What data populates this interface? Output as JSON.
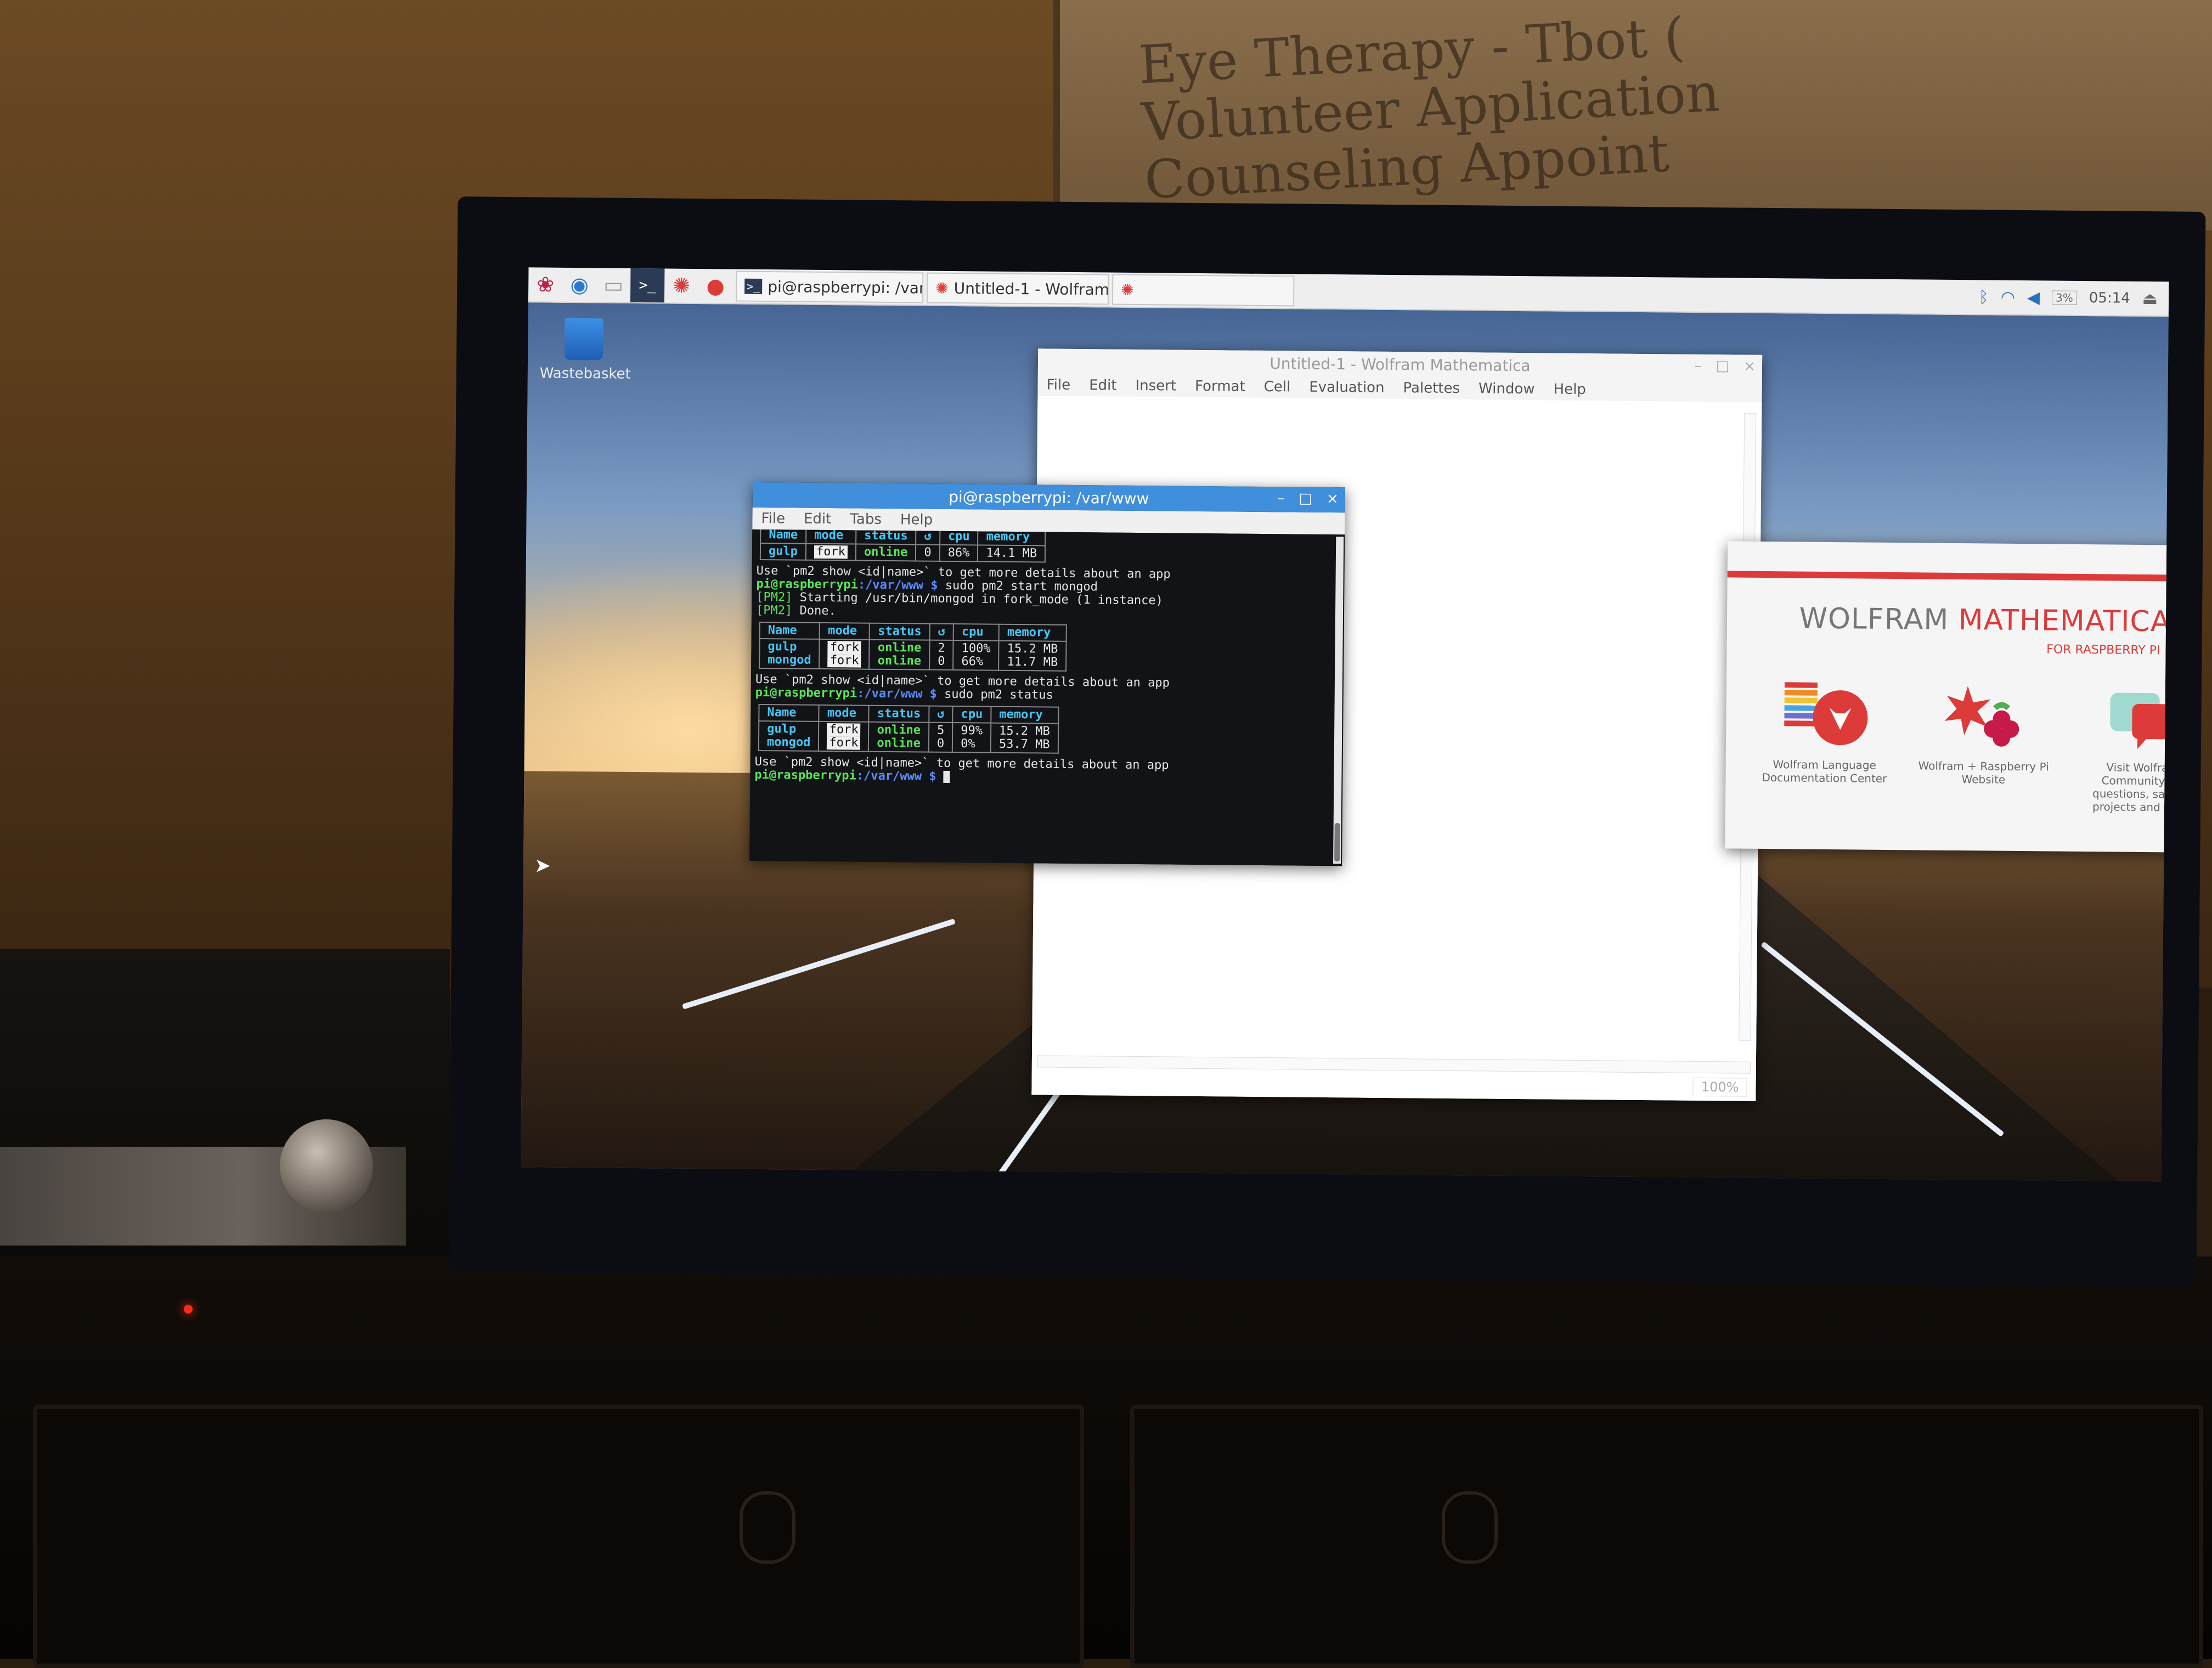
{
  "whiteboard": {
    "lines": [
      "Eye Therapy - Tbot (",
      "Volunteer Application",
      "Counseling Appoint"
    ]
  },
  "taskbar": {
    "launchers": [
      {
        "name": "raspberry-menu",
        "icon": "raspberry-icon",
        "glyph": "❀"
      },
      {
        "name": "browser",
        "icon": "globe-icon",
        "glyph": "◉"
      },
      {
        "name": "files",
        "icon": "folder-icon",
        "glyph": "▭"
      },
      {
        "name": "terminal",
        "icon": "terminal-icon",
        "glyph": ">_"
      },
      {
        "name": "mathematica",
        "icon": "wolfram-icon",
        "glyph": "✺"
      },
      {
        "name": "wolfram",
        "icon": "wolf-icon",
        "glyph": "●"
      }
    ],
    "tasks": [
      {
        "label": "pi@raspberrypi: /var/...",
        "icon": "terminal-icon",
        "glyph": ">_"
      },
      {
        "label": "Untitled-1 - Wolfram ...",
        "icon": "wolfram-icon",
        "glyph": "✺"
      },
      {
        "label": "",
        "icon": "wolfram-icon",
        "glyph": "✺"
      }
    ],
    "tray": {
      "bluetooth": "ᛒ",
      "wifi": "◠",
      "volume": "◀",
      "cpu": "3%",
      "clock": "05:14",
      "eject": "⏏"
    }
  },
  "desktop": {
    "wastebasket": "Wastebasket"
  },
  "mathematica_window": {
    "title": "Untitled-1 - Wolfram Mathematica",
    "menu": [
      "File",
      "Edit",
      "Insert",
      "Format",
      "Cell",
      "Evaluation",
      "Palettes",
      "Window",
      "Help"
    ],
    "zoom": "100%"
  },
  "terminal": {
    "title": "pi@raspberrypi: /var/www",
    "menu": [
      "File",
      "Edit",
      "Tabs",
      "Help"
    ],
    "headers": [
      "Name",
      "mode",
      "status",
      "↺",
      "cpu",
      "memory"
    ],
    "table1": [
      {
        "name": "gulp",
        "mode": "fork",
        "status": "online",
        "restarts": "0",
        "cpu": "86%",
        "memory": "14.1 MB"
      }
    ],
    "hint": "Use `pm2 show <id|name>` to get more details about an app",
    "prompt": "pi@raspberrypi",
    "path": ":/var/www $",
    "cmd1": " sudo pm2 start mongod",
    "pm2_tag": "[PM2]",
    "msg1": " Starting /usr/bin/mongod in fork_mode (1 instance)",
    "msg2": " Done.",
    "table2": [
      {
        "name": "gulp",
        "mode": "fork",
        "status": "online",
        "restarts": "2",
        "cpu": "100%",
        "memory": "15.2 MB"
      },
      {
        "name": "mongod",
        "mode": "fork",
        "status": "online",
        "restarts": "0",
        "cpu": "66%",
        "memory": "11.7 MB"
      }
    ],
    "cmd2": " sudo pm2 status",
    "table3": [
      {
        "name": "gulp",
        "mode": "fork",
        "status": "online",
        "restarts": "5",
        "cpu": "99%",
        "memory": "15.2 MB"
      },
      {
        "name": "mongod",
        "mode": "fork",
        "status": "online",
        "restarts": "0",
        "cpu": "0%",
        "memory": "53.7 MB"
      }
    ]
  },
  "welcome": {
    "brand_a": "WOLFRAM ",
    "brand_b": "MATHEMATICA",
    "subtitle": "FOR RASPBERRY PI",
    "tiles": [
      {
        "label": "Wolfram Language Documentation Center",
        "icon": "documentation-icon"
      },
      {
        "label": "Wolfram + Raspberry Pi Website",
        "icon": "raspberry-wolfram-icon"
      },
      {
        "label": "Visit Wolfram Community for questions, sample projects and more",
        "icon": "community-icon"
      }
    ]
  },
  "colors": {
    "accent_red": "#dd3a3a",
    "terminal_blue": "#3f8fdc",
    "online_green": "#5be35b",
    "header_cyan": "#44c7f5"
  }
}
